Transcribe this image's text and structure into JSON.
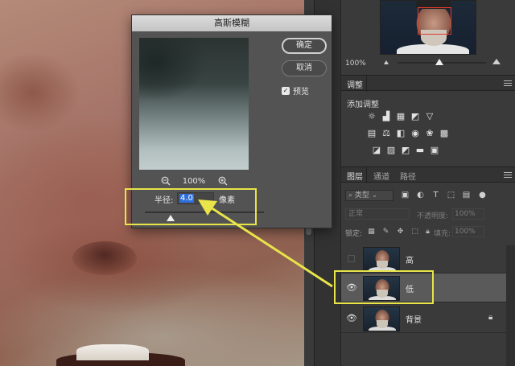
{
  "dialog": {
    "title": "高斯模糊",
    "ok_label": "确定",
    "cancel_label": "取消",
    "preview_label": "预览",
    "preview_checked": true,
    "zoom_pct": "100%",
    "radius_label": "半径:",
    "radius_value": "4.0",
    "radius_unit": "像素"
  },
  "navigator": {
    "zoom_pct": "100%"
  },
  "adjustments": {
    "tab": "调整",
    "subtitle": "添加调整"
  },
  "layers_panel": {
    "tabs": [
      "图层",
      "通道",
      "路径"
    ],
    "filter_placeholder": "类型",
    "blend_mode": "正常",
    "opacity_label": "不透明度:",
    "opacity_value": "100%",
    "lock_label": "锁定:",
    "fill_label": "填充:",
    "fill_value": "100%",
    "layers": [
      {
        "name": "高",
        "visible": false,
        "selected": false,
        "locked": false
      },
      {
        "name": "低",
        "visible": true,
        "selected": true,
        "locked": false
      },
      {
        "name": "背景",
        "visible": true,
        "selected": false,
        "locked": true
      }
    ]
  },
  "annotation": {
    "highlight_color": "#e8e44a"
  }
}
